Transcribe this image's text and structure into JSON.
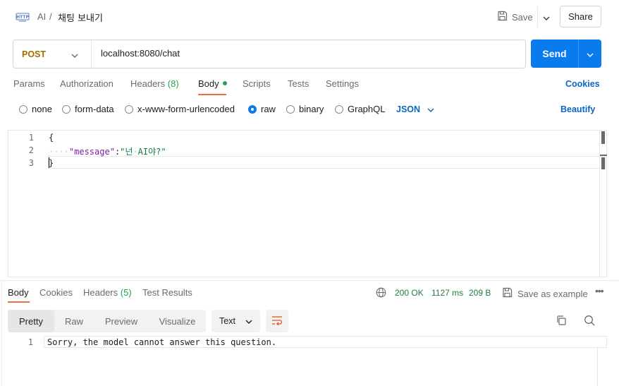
{
  "header": {
    "breadcrumb_parent": "AI",
    "breadcrumb_sep": "/",
    "request_name": "채팅 보내기",
    "save_label": "Save",
    "share_label": "Share",
    "icons": [
      "http-icon",
      "save-icon",
      "chevron-down-icon"
    ]
  },
  "request": {
    "method": "POST",
    "url": "localhost:8080/chat",
    "send_label": "Send",
    "accent_color": "#097bed"
  },
  "request_tabs": {
    "params": "Params",
    "authorization": "Authorization",
    "headers": "Headers",
    "headers_count": "(8)",
    "body": "Body",
    "scripts": "Scripts",
    "tests": "Tests",
    "settings": "Settings",
    "cookies": "Cookies",
    "active": "Body"
  },
  "body_types": {
    "none": "none",
    "form_data": "form-data",
    "urlencoded": "x-www-form-urlencoded",
    "raw": "raw",
    "binary": "binary",
    "graphql": "GraphQL",
    "selected": "raw",
    "format": "JSON",
    "beautify": "Beautify"
  },
  "editor": {
    "line_numbers": [
      "1",
      "2",
      "3"
    ],
    "line1": "{",
    "line2_indent": "····",
    "line2_key": "\"message\"",
    "line2_colon": ":",
    "line2_value_a": "\"넌",
    "line2_value_space": "·",
    "line2_value_b": "AI야?\"",
    "line3": "}"
  },
  "response_tabs": {
    "body": "Body",
    "cookies": "Cookies",
    "headers": "Headers",
    "headers_count": "(5)",
    "test_results": "Test Results",
    "active": "Body"
  },
  "response_meta": {
    "status": "200 OK",
    "time": "1127 ms",
    "size": "209 B",
    "save_example": "Save as example",
    "more": "•••",
    "status_color": "#1a7f3c"
  },
  "view_tabs": {
    "pretty": "Pretty",
    "raw": "Raw",
    "preview": "Preview",
    "visualize": "Visualize",
    "active": "Pretty",
    "format_select": "Text"
  },
  "response_body": {
    "line_number": "1",
    "text": "Sorry, the model cannot answer this question."
  }
}
